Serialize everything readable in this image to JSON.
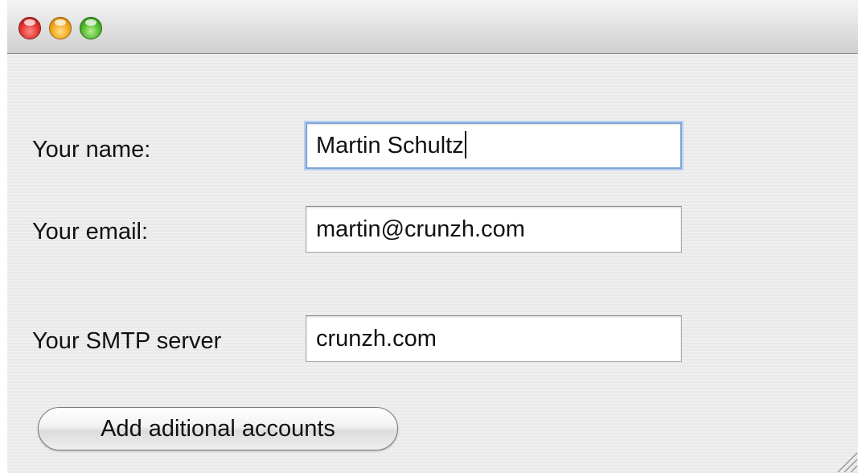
{
  "window": {
    "controls": [
      "close",
      "minimize",
      "zoom"
    ]
  },
  "form": {
    "name_label": "Your name:",
    "name_value": "Martin Schultz",
    "email_label": "Your email:",
    "email_value": "martin@crunzh.com",
    "smtp_label": "Your SMTP server",
    "smtp_value": "crunzh.com",
    "add_accounts_button": "Add aditional accounts"
  },
  "icons": {
    "close": "close-button-icon",
    "minimize": "minimize-button-icon",
    "zoom": "zoom-button-icon",
    "resize": "resize-grip-icon"
  },
  "colors": {
    "close": "#e0302a",
    "minimize": "#f0a415",
    "zoom": "#4bb52a",
    "focus_ring": "#7ea6d6"
  }
}
